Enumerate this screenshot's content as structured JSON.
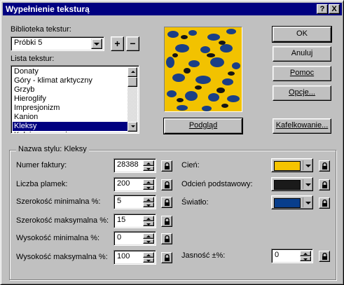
{
  "dialog": {
    "title": "Wypełnienie teksturą",
    "help_label": "?",
    "close_label": "X"
  },
  "library": {
    "label": "Biblioteka tekstur:",
    "selected": "Próbki 5",
    "add_label": "+",
    "remove_label": "−"
  },
  "texture_list": {
    "label": "Lista tekstur:",
    "items": [
      {
        "label": "Donaty"
      },
      {
        "label": "Góry - klimat arktyczny"
      },
      {
        "label": "Grzyb"
      },
      {
        "label": "Hieroglify"
      },
      {
        "label": "Impresjonizm"
      },
      {
        "label": "Kanion"
      },
      {
        "label": "Kleksy"
      },
      {
        "label": "Kołnierz ceramiczny"
      }
    ],
    "selected_index": 6
  },
  "buttons": {
    "ok": "OK",
    "cancel": "Anuluj",
    "help": "Pomoc",
    "options": "Opcje...",
    "preview": "Podgląd",
    "tiling": "Kafelkowanie..."
  },
  "style_group": {
    "title": "Nazwa stylu: Kleksy",
    "left_fields": [
      {
        "label": "Numer faktury:",
        "value": "28388"
      },
      {
        "label": "Liczba plamek:",
        "value": "200"
      },
      {
        "label": "Szerokość minimalna %:",
        "value": "5"
      },
      {
        "label": "Szerokość maksymalna %:",
        "value": "15"
      },
      {
        "label": "Wysokość minimalna %:",
        "value": "0"
      },
      {
        "label": "Wysokość maksymalna %:",
        "value": "100"
      }
    ],
    "color_fields": [
      {
        "label": "Cień:",
        "color": "#f5c400"
      },
      {
        "label": "Odcień podstawowy:",
        "color": "#1a1a1a"
      },
      {
        "label": "Światło:",
        "color": "#083e8c"
      }
    ],
    "brightness": {
      "label": "Jasność ±%:",
      "value": "0"
    }
  }
}
